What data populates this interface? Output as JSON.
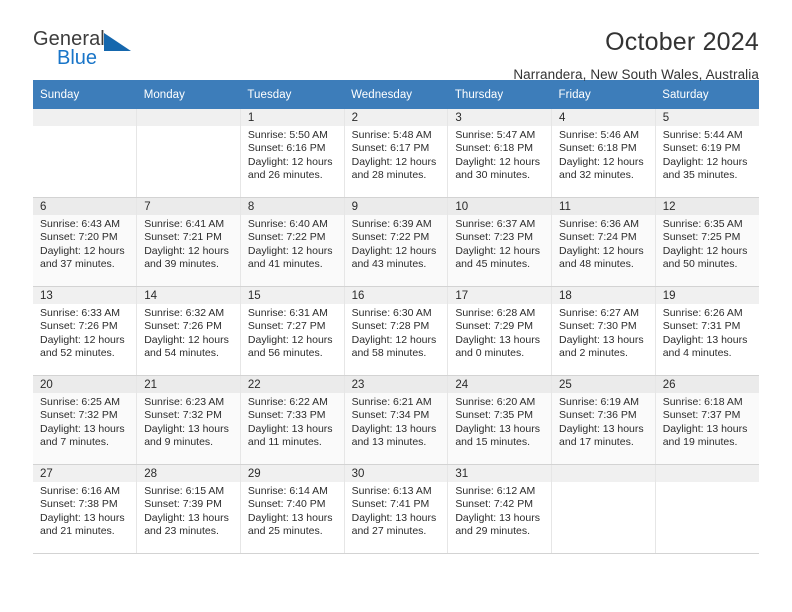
{
  "brand": {
    "name_part1": "General",
    "name_part2": "Blue",
    "accent_color": "#1975c8",
    "triangle_color": "#1567ad",
    "logo_icon": "triangle-icon"
  },
  "header": {
    "title": "October 2024",
    "subtitle": "Narrandera, New South Wales, Australia",
    "header_bg_color": "#3d7dba"
  },
  "calendar": {
    "weekday_headers": [
      "Sunday",
      "Monday",
      "Tuesday",
      "Wednesday",
      "Thursday",
      "Friday",
      "Saturday"
    ],
    "labels": {
      "sunrise": "Sunrise:",
      "sunset": "Sunset:",
      "daylight": "Daylight:"
    },
    "weeks": [
      [
        {
          "day": "",
          "sunrise": "",
          "sunset": "",
          "daylight_line1": "",
          "daylight_line2": ""
        },
        {
          "day": "",
          "sunrise": "",
          "sunset": "",
          "daylight_line1": "",
          "daylight_line2": ""
        },
        {
          "day": "1",
          "sunrise": "Sunrise: 5:50 AM",
          "sunset": "Sunset: 6:16 PM",
          "daylight_line1": "Daylight: 12 hours",
          "daylight_line2": "and 26 minutes."
        },
        {
          "day": "2",
          "sunrise": "Sunrise: 5:48 AM",
          "sunset": "Sunset: 6:17 PM",
          "daylight_line1": "Daylight: 12 hours",
          "daylight_line2": "and 28 minutes."
        },
        {
          "day": "3",
          "sunrise": "Sunrise: 5:47 AM",
          "sunset": "Sunset: 6:18 PM",
          "daylight_line1": "Daylight: 12 hours",
          "daylight_line2": "and 30 minutes."
        },
        {
          "day": "4",
          "sunrise": "Sunrise: 5:46 AM",
          "sunset": "Sunset: 6:18 PM",
          "daylight_line1": "Daylight: 12 hours",
          "daylight_line2": "and 32 minutes."
        },
        {
          "day": "5",
          "sunrise": "Sunrise: 5:44 AM",
          "sunset": "Sunset: 6:19 PM",
          "daylight_line1": "Daylight: 12 hours",
          "daylight_line2": "and 35 minutes."
        }
      ],
      [
        {
          "day": "6",
          "sunrise": "Sunrise: 6:43 AM",
          "sunset": "Sunset: 7:20 PM",
          "daylight_line1": "Daylight: 12 hours",
          "daylight_line2": "and 37 minutes."
        },
        {
          "day": "7",
          "sunrise": "Sunrise: 6:41 AM",
          "sunset": "Sunset: 7:21 PM",
          "daylight_line1": "Daylight: 12 hours",
          "daylight_line2": "and 39 minutes."
        },
        {
          "day": "8",
          "sunrise": "Sunrise: 6:40 AM",
          "sunset": "Sunset: 7:22 PM",
          "daylight_line1": "Daylight: 12 hours",
          "daylight_line2": "and 41 minutes."
        },
        {
          "day": "9",
          "sunrise": "Sunrise: 6:39 AM",
          "sunset": "Sunset: 7:22 PM",
          "daylight_line1": "Daylight: 12 hours",
          "daylight_line2": "and 43 minutes."
        },
        {
          "day": "10",
          "sunrise": "Sunrise: 6:37 AM",
          "sunset": "Sunset: 7:23 PM",
          "daylight_line1": "Daylight: 12 hours",
          "daylight_line2": "and 45 minutes."
        },
        {
          "day": "11",
          "sunrise": "Sunrise: 6:36 AM",
          "sunset": "Sunset: 7:24 PM",
          "daylight_line1": "Daylight: 12 hours",
          "daylight_line2": "and 48 minutes."
        },
        {
          "day": "12",
          "sunrise": "Sunrise: 6:35 AM",
          "sunset": "Sunset: 7:25 PM",
          "daylight_line1": "Daylight: 12 hours",
          "daylight_line2": "and 50 minutes."
        }
      ],
      [
        {
          "day": "13",
          "sunrise": "Sunrise: 6:33 AM",
          "sunset": "Sunset: 7:26 PM",
          "daylight_line1": "Daylight: 12 hours",
          "daylight_line2": "and 52 minutes."
        },
        {
          "day": "14",
          "sunrise": "Sunrise: 6:32 AM",
          "sunset": "Sunset: 7:26 PM",
          "daylight_line1": "Daylight: 12 hours",
          "daylight_line2": "and 54 minutes."
        },
        {
          "day": "15",
          "sunrise": "Sunrise: 6:31 AM",
          "sunset": "Sunset: 7:27 PM",
          "daylight_line1": "Daylight: 12 hours",
          "daylight_line2": "and 56 minutes."
        },
        {
          "day": "16",
          "sunrise": "Sunrise: 6:30 AM",
          "sunset": "Sunset: 7:28 PM",
          "daylight_line1": "Daylight: 12 hours",
          "daylight_line2": "and 58 minutes."
        },
        {
          "day": "17",
          "sunrise": "Sunrise: 6:28 AM",
          "sunset": "Sunset: 7:29 PM",
          "daylight_line1": "Daylight: 13 hours",
          "daylight_line2": "and 0 minutes."
        },
        {
          "day": "18",
          "sunrise": "Sunrise: 6:27 AM",
          "sunset": "Sunset: 7:30 PM",
          "daylight_line1": "Daylight: 13 hours",
          "daylight_line2": "and 2 minutes."
        },
        {
          "day": "19",
          "sunrise": "Sunrise: 6:26 AM",
          "sunset": "Sunset: 7:31 PM",
          "daylight_line1": "Daylight: 13 hours",
          "daylight_line2": "and 4 minutes."
        }
      ],
      [
        {
          "day": "20",
          "sunrise": "Sunrise: 6:25 AM",
          "sunset": "Sunset: 7:32 PM",
          "daylight_line1": "Daylight: 13 hours",
          "daylight_line2": "and 7 minutes."
        },
        {
          "day": "21",
          "sunrise": "Sunrise: 6:23 AM",
          "sunset": "Sunset: 7:32 PM",
          "daylight_line1": "Daylight: 13 hours",
          "daylight_line2": "and 9 minutes."
        },
        {
          "day": "22",
          "sunrise": "Sunrise: 6:22 AM",
          "sunset": "Sunset: 7:33 PM",
          "daylight_line1": "Daylight: 13 hours",
          "daylight_line2": "and 11 minutes."
        },
        {
          "day": "23",
          "sunrise": "Sunrise: 6:21 AM",
          "sunset": "Sunset: 7:34 PM",
          "daylight_line1": "Daylight: 13 hours",
          "daylight_line2": "and 13 minutes."
        },
        {
          "day": "24",
          "sunrise": "Sunrise: 6:20 AM",
          "sunset": "Sunset: 7:35 PM",
          "daylight_line1": "Daylight: 13 hours",
          "daylight_line2": "and 15 minutes."
        },
        {
          "day": "25",
          "sunrise": "Sunrise: 6:19 AM",
          "sunset": "Sunset: 7:36 PM",
          "daylight_line1": "Daylight: 13 hours",
          "daylight_line2": "and 17 minutes."
        },
        {
          "day": "26",
          "sunrise": "Sunrise: 6:18 AM",
          "sunset": "Sunset: 7:37 PM",
          "daylight_line1": "Daylight: 13 hours",
          "daylight_line2": "and 19 minutes."
        }
      ],
      [
        {
          "day": "27",
          "sunrise": "Sunrise: 6:16 AM",
          "sunset": "Sunset: 7:38 PM",
          "daylight_line1": "Daylight: 13 hours",
          "daylight_line2": "and 21 minutes."
        },
        {
          "day": "28",
          "sunrise": "Sunrise: 6:15 AM",
          "sunset": "Sunset: 7:39 PM",
          "daylight_line1": "Daylight: 13 hours",
          "daylight_line2": "and 23 minutes."
        },
        {
          "day": "29",
          "sunrise": "Sunrise: 6:14 AM",
          "sunset": "Sunset: 7:40 PM",
          "daylight_line1": "Daylight: 13 hours",
          "daylight_line2": "and 25 minutes."
        },
        {
          "day": "30",
          "sunrise": "Sunrise: 6:13 AM",
          "sunset": "Sunset: 7:41 PM",
          "daylight_line1": "Daylight: 13 hours",
          "daylight_line2": "and 27 minutes."
        },
        {
          "day": "31",
          "sunrise": "Sunrise: 6:12 AM",
          "sunset": "Sunset: 7:42 PM",
          "daylight_line1": "Daylight: 13 hours",
          "daylight_line2": "and 29 minutes."
        },
        {
          "day": "",
          "sunrise": "",
          "sunset": "",
          "daylight_line1": "",
          "daylight_line2": ""
        },
        {
          "day": "",
          "sunrise": "",
          "sunset": "",
          "daylight_line1": "",
          "daylight_line2": ""
        }
      ]
    ]
  }
}
